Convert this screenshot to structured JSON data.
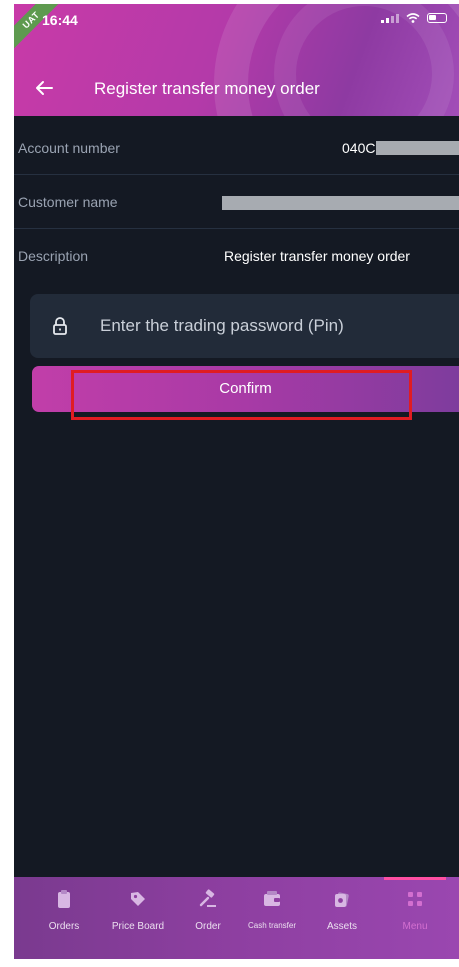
{
  "status_bar": {
    "time": "16:44",
    "env_badge": "UAT"
  },
  "header": {
    "title": "Register transfer money order"
  },
  "form": {
    "account_label": "Account number",
    "account_value": "040C",
    "customer_label": "Customer name",
    "customer_value": "",
    "description_label": "Description",
    "description_value": "Register transfer money order",
    "pin_placeholder": "Enter the trading password (Pin)",
    "confirm_label": "Confirm"
  },
  "tabs": [
    {
      "label": "Orders",
      "icon": "clipboard-icon"
    },
    {
      "label": "Price Board",
      "icon": "tag-icon"
    },
    {
      "label": "Order",
      "icon": "gavel-icon"
    },
    {
      "label": "Cash transfer",
      "icon": "wallet-icon"
    },
    {
      "label": "Assets",
      "icon": "coins-icon"
    },
    {
      "label": "Menu",
      "icon": "grid-icon"
    }
  ],
  "active_tab": "Menu",
  "colors": {
    "background": "#141923",
    "accent": "#c13ea9",
    "highlight": "#e01c22"
  }
}
